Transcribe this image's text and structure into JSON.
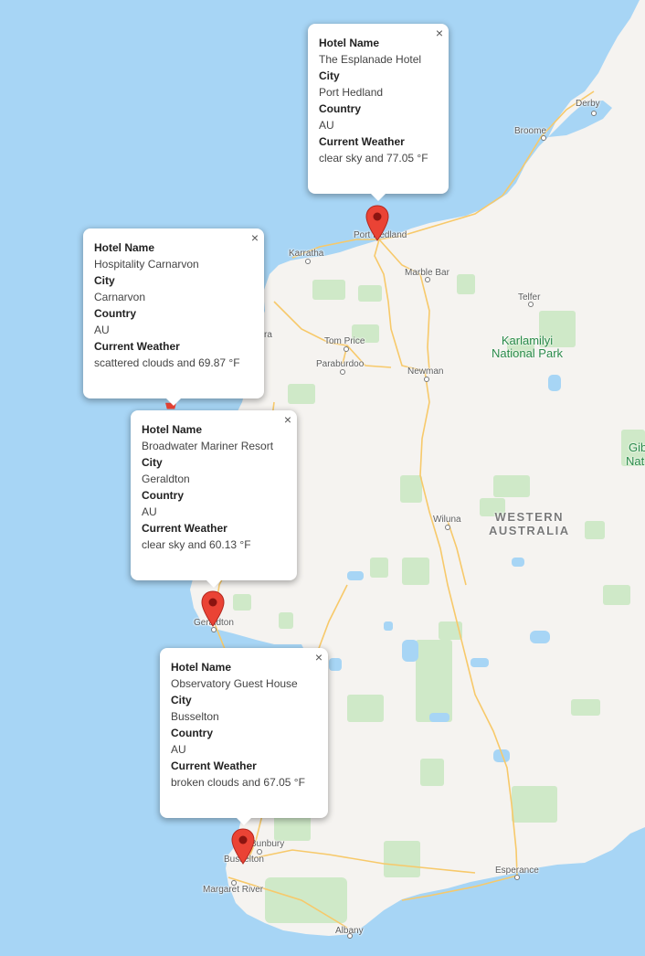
{
  "places": {
    "derby": "Derby",
    "broome": "Broome",
    "port_hedland": "Port Hedland",
    "karratha": "Karratha",
    "marble_bar": "Marble Bar",
    "telfer": "Telfer",
    "tom_price": "Tom Price",
    "paraburdoo": "Paraburdoo",
    "newman": "Newman",
    "wiluna": "Wiluna",
    "geraldton": "Geraldton",
    "bunbury": "Bunbury",
    "busselton": "Busselton",
    "margaret_river": "Margaret River",
    "albany": "Albany",
    "esperance": "Esperance",
    "ra_partial": "ra",
    "gib_partial": "Gib",
    "nat_partial": "Nat"
  },
  "park": {
    "line1": "Karlamilyi",
    "line2": "National Park"
  },
  "region": {
    "line1": "WESTERN",
    "line2": "AUSTRALIA"
  },
  "popups": [
    {
      "hotel_label": "Hotel Name",
      "hotel": "The Esplanade Hotel",
      "city_label": "City",
      "city": "Port Hedland",
      "country_label": "Country",
      "country": "AU",
      "weather_label": "Current Weather",
      "weather": "clear sky and 77.05 °F",
      "close": "×"
    },
    {
      "hotel_label": "Hotel Name",
      "hotel": "Hospitality Carnarvon",
      "city_label": "City",
      "city": "Carnarvon",
      "country_label": "Country",
      "country": "AU",
      "weather_label": "Current Weather",
      "weather": "scattered clouds and 69.87 °F",
      "close": "×"
    },
    {
      "hotel_label": "Hotel Name",
      "hotel": "Broadwater Mariner Resort",
      "city_label": "City",
      "city": "Geraldton",
      "country_label": "Country",
      "country": "AU",
      "weather_label": "Current Weather",
      "weather": "clear sky and 60.13 °F",
      "close": "×"
    },
    {
      "hotel_label": "Hotel Name",
      "hotel": "Observatory Guest House",
      "city_label": "City",
      "city": "Busselton",
      "country_label": "Country",
      "country": "AU",
      "weather_label": "Current Weather",
      "weather": "broken clouds and 67.05 °F",
      "close": "×"
    }
  ],
  "colors": {
    "ocean": "#a7d5f5",
    "land": "#f5f3f0",
    "vegetation": "#cfe9c8",
    "road": "#f7c96a",
    "marker": "#ea4335",
    "marker_dot": "#8b1410"
  },
  "icons": {
    "marker": "map-pin-icon",
    "close": "close-icon"
  }
}
